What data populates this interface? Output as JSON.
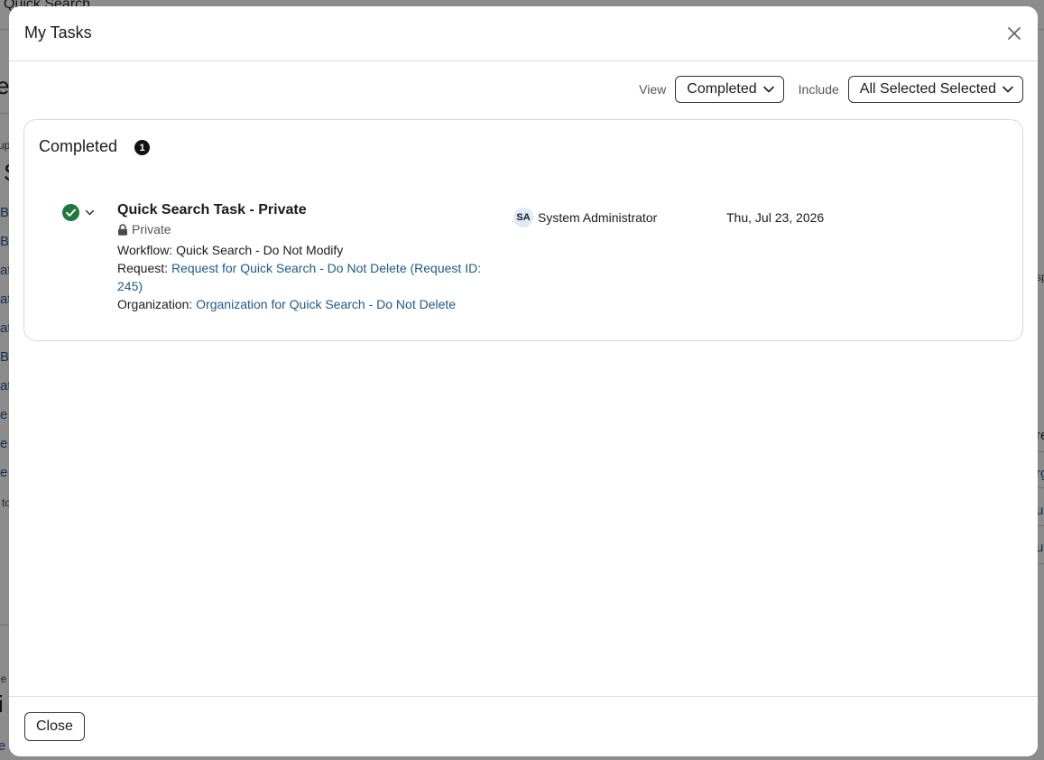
{
  "background": {
    "topbar_title": "Quick Search",
    "fragments": [
      "e",
      "up",
      "S",
      "B",
      "B",
      "at",
      "at",
      "at",
      "Ba",
      "at",
      "e",
      "e",
      "e",
      "to",
      "sp",
      "re",
      "rg",
      "u",
      "u",
      "ie",
      "i",
      "e"
    ]
  },
  "modal": {
    "title": "My Tasks",
    "view_label": "View",
    "view_value": "Completed",
    "include_label": "Include",
    "include_value": "All Selected Selected",
    "section_title": "Completed",
    "section_count": "1",
    "task": {
      "title": "Quick Search Task - Private",
      "visibility": "Private",
      "workflow_label": "Workflow:",
      "workflow_value": "Quick Search - Do Not Modify",
      "request_label": "Request:",
      "request_link_line1": "Request for Quick Search - Do Not Delete (Request ID:",
      "request_link_line2": "245)",
      "organization_label": "Organization:",
      "organization_link": "Organization for Quick Search - Do Not Delete",
      "assignee_initials": "SA",
      "assignee_name": "System Administrator",
      "date": "Thu, Jul 23, 2026"
    },
    "close_button": "Close"
  },
  "icons": {
    "close": "close-icon",
    "chevron": "chevron-down-icon",
    "check": "check-circle-icon",
    "lock": "lock-icon"
  },
  "colors": {
    "success": "#1e7a3c",
    "link": "#1f5a8a",
    "avatar_bg": "#dfeaf5"
  }
}
